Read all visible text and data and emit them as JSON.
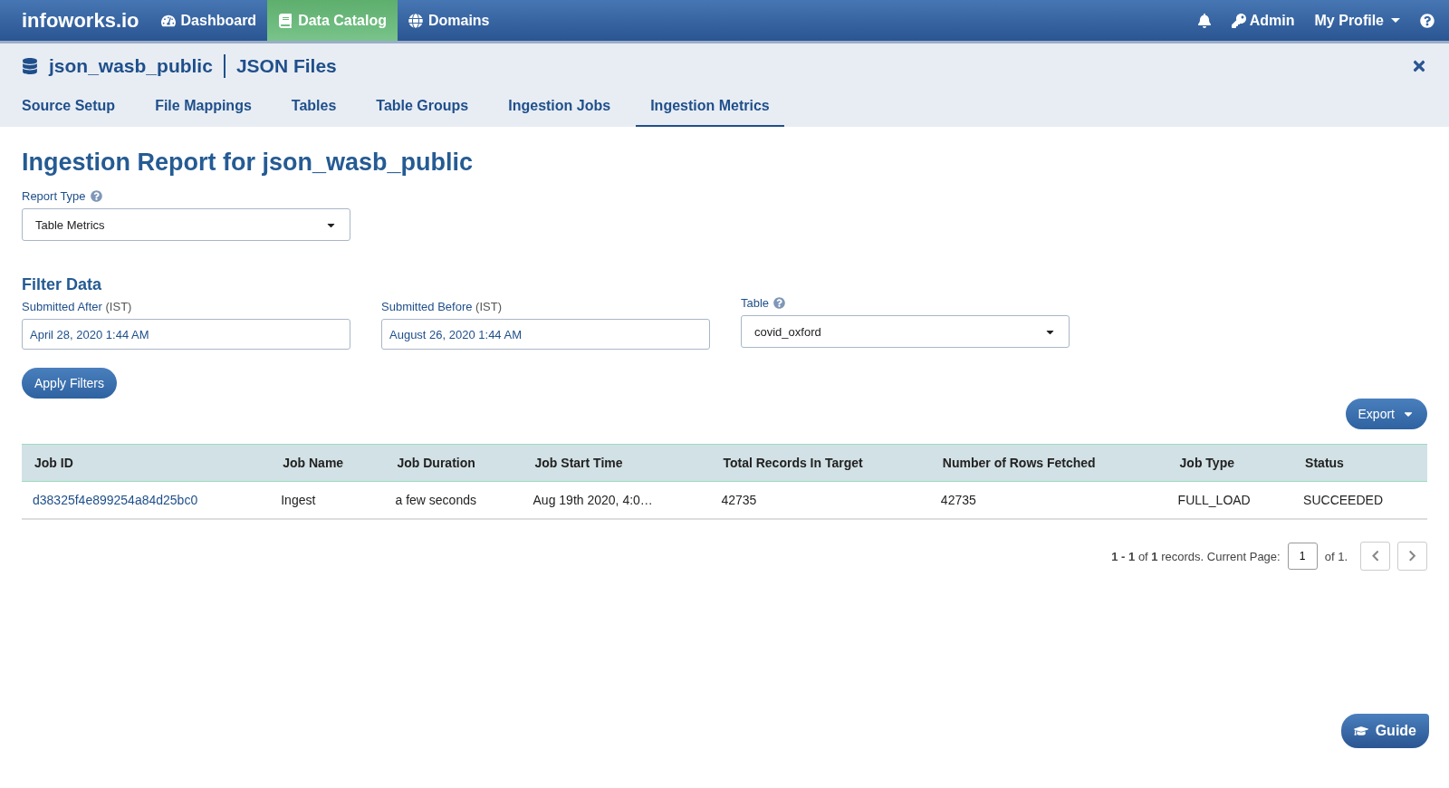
{
  "nav": {
    "logo": "infoworks.io",
    "items": [
      {
        "label": "Dashboard",
        "selected": false
      },
      {
        "label": "Data Catalog",
        "selected": true
      },
      {
        "label": "Domains",
        "selected": false
      }
    ],
    "right": [
      {
        "kind": "bell"
      },
      {
        "kind": "key",
        "label": "Admin"
      },
      {
        "kind": "dropdown",
        "label": "My Profile"
      },
      {
        "kind": "help"
      }
    ]
  },
  "source": {
    "name": "json_wasb_public",
    "type": "JSON Files"
  },
  "tabs": [
    {
      "label": "Source Setup",
      "selected": false
    },
    {
      "label": "File Mappings",
      "selected": false
    },
    {
      "label": "Tables",
      "selected": false
    },
    {
      "label": "Table Groups",
      "selected": false
    },
    {
      "label": "Ingestion Jobs",
      "selected": false
    },
    {
      "label": "Ingestion Metrics",
      "selected": true
    }
  ],
  "title": "Ingestion Report for json_wasb_public",
  "report_type": {
    "label": "Report Type",
    "value": "Table Metrics"
  },
  "filter": {
    "heading": "Filter Data",
    "submitted_after": {
      "label": "Submitted After",
      "suffix": "(IST)",
      "value": "April 28, 2020 1:44 AM"
    },
    "submitted_before": {
      "label": "Submitted Before",
      "suffix": "(IST)",
      "value": "August 26, 2020 1:44 AM"
    },
    "table": {
      "label": "Table",
      "value": "covid_oxford"
    },
    "apply": "Apply Filters"
  },
  "export": "Export",
  "table": {
    "columns": [
      "Job ID",
      "Job Name",
      "Job Duration",
      "Job Start Time",
      "Total Records In Target",
      "Number of Rows Fetched",
      "Job Type",
      "Status"
    ],
    "rows": [
      {
        "cells": [
          {
            "kind": "link",
            "text": "d38325f4e899254a84d25bc0"
          },
          {
            "kind": "text",
            "text": "Ingest"
          },
          {
            "kind": "text",
            "text": "a few seconds"
          },
          {
            "kind": "text",
            "text": "Aug 19th 2020, 4:0…"
          },
          {
            "kind": "text",
            "text": "42735"
          },
          {
            "kind": "text",
            "text": "42735"
          },
          {
            "kind": "text",
            "text": "FULL_LOAD"
          },
          {
            "kind": "text",
            "text": "SUCCEEDED"
          }
        ]
      }
    ]
  },
  "pagination": {
    "summary": "**1 - 1** of **1** records. Current Page:",
    "page": "1",
    "of": "of 1."
  },
  "guide": "Guide"
}
